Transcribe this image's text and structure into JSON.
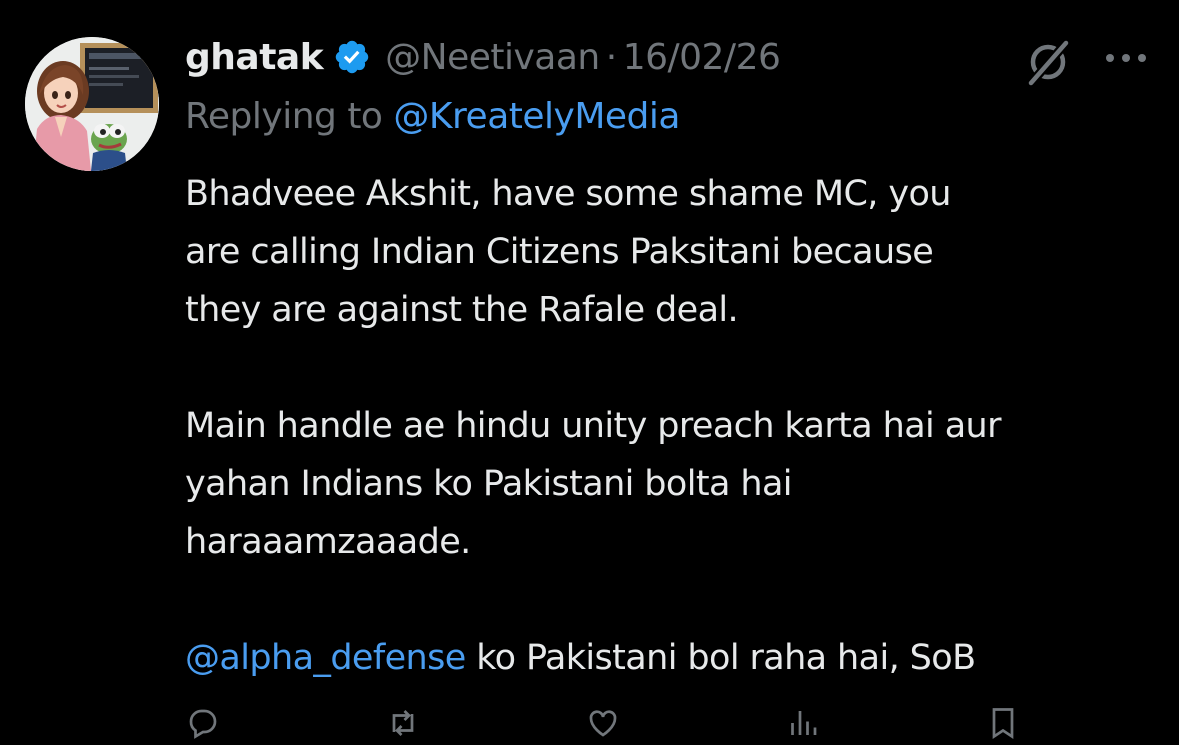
{
  "tweet": {
    "display_name": "ghatak",
    "handle": "@Neetivaan",
    "separator": "·",
    "date": "16/02/26",
    "replying_prefix": "Replying to",
    "replying_to": "@KreatelyMedia",
    "paragraphs": [
      {
        "lines": [
          "Bhadveee Akshit, have some shame MC, you",
          "are calling Indian Citizens Paksitani because",
          "they are against the Rafale deal."
        ]
      },
      {
        "lines": [
          "Main handle ae hindu unity preach karta hai aur",
          "yahan Indians ko Pakistani bolta hai",
          "haraaamzaaade."
        ]
      }
    ],
    "last_line_mention": "@alpha_defense",
    "last_line_rest": " ko Pakistani bol raha hai, SoB"
  },
  "icons": {
    "verified": "verified-badge-icon",
    "grok": "grok-icon",
    "more": "more-options-icon",
    "reply": "reply-icon",
    "repost": "repost-icon",
    "like": "like-icon",
    "views": "views-icon",
    "bookmark": "bookmark-icon"
  },
  "colors": {
    "background": "#000000",
    "text": "#e7e9ea",
    "secondary": "#71767b",
    "link": "#4a9df0",
    "verified": "#1d9bf0"
  }
}
